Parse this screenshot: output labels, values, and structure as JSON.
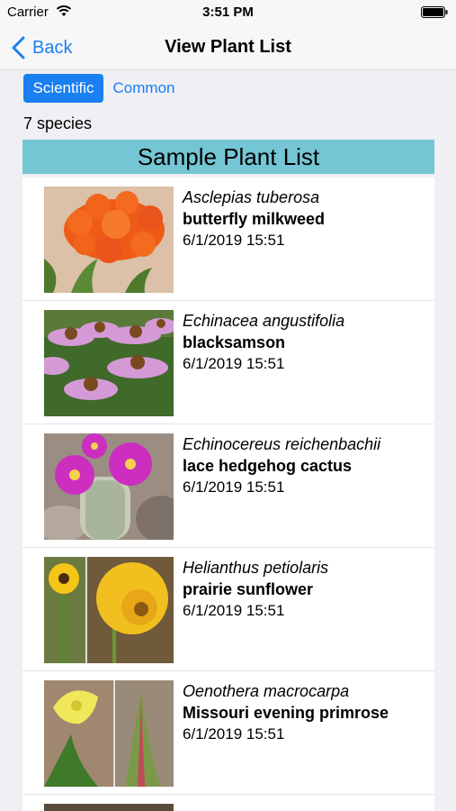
{
  "status_bar": {
    "carrier": "Carrier",
    "time": "3:51 PM"
  },
  "nav": {
    "back_label": "Back",
    "title": "View Plant List"
  },
  "toggle": {
    "scientific_label": "Scientific",
    "common_label": "Common",
    "selected": "Scientific"
  },
  "species_count": "7 species",
  "list": {
    "title": "Sample Plant List",
    "items": [
      {
        "scientific": "Asclepias tuberosa",
        "common": "butterfly milkweed",
        "date": "6/1/2019 15:51",
        "thumbnail_icon": "orange-flower-photo"
      },
      {
        "scientific": "Echinacea angustifolia",
        "common": "blacksamson",
        "date": "6/1/2019 15:51",
        "thumbnail_icon": "purple-coneflower-photo"
      },
      {
        "scientific": "Echinocereus reichenbachii",
        "common": "lace hedgehog cactus",
        "date": "6/1/2019 15:51",
        "thumbnail_icon": "cactus-bloom-photo"
      },
      {
        "scientific": "Helianthus petiolaris",
        "common": "prairie sunflower",
        "date": "6/1/2019 15:51",
        "thumbnail_icon": "sunflower-photo"
      },
      {
        "scientific": "Oenothera macrocarpa",
        "common": "Missouri evening primrose",
        "date": "6/1/2019 15:51",
        "thumbnail_icon": "primrose-photo"
      }
    ]
  },
  "colors": {
    "accent": "#1a7ff0",
    "header_bg": "#75c6d4",
    "background": "#efeff4"
  }
}
